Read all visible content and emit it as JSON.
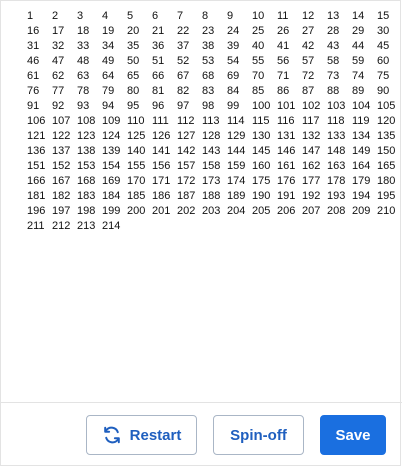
{
  "numbers": [
    "1",
    "2",
    "3",
    "4",
    "5",
    "6",
    "7",
    "8",
    "9",
    "10",
    "11",
    "12",
    "13",
    "14",
    "15",
    "16",
    "17",
    "18",
    "19",
    "20",
    "21",
    "22",
    "23",
    "24",
    "25",
    "26",
    "27",
    "28",
    "29",
    "30",
    "31",
    "32",
    "33",
    "34",
    "35",
    "36",
    "37",
    "38",
    "39",
    "40",
    "41",
    "42",
    "43",
    "44",
    "45",
    "46",
    "47",
    "48",
    "49",
    "50",
    "51",
    "52",
    "53",
    "54",
    "55",
    "56",
    "57",
    "58",
    "59",
    "60",
    "61",
    "62",
    "63",
    "64",
    "65",
    "66",
    "67",
    "68",
    "69",
    "70",
    "71",
    "72",
    "73",
    "74",
    "75",
    "76",
    "77",
    "78",
    "79",
    "80",
    "81",
    "82",
    "83",
    "84",
    "85",
    "86",
    "87",
    "88",
    "89",
    "90",
    "91",
    "92",
    "93",
    "94",
    "95",
    "96",
    "97",
    "98",
    "99",
    "100",
    "101",
    "102",
    "103",
    "104",
    "105",
    "106",
    "107",
    "108",
    "109",
    "110",
    "111",
    "112",
    "113",
    "114",
    "115",
    "116",
    "117",
    "118",
    "119",
    "120",
    "121",
    "122",
    "123",
    "124",
    "125",
    "126",
    "127",
    "128",
    "129",
    "130",
    "131",
    "132",
    "133",
    "134",
    "135",
    "136",
    "137",
    "138",
    "139",
    "140",
    "141",
    "142",
    "143",
    "144",
    "145",
    "146",
    "147",
    "148",
    "149",
    "150",
    "151",
    "152",
    "153",
    "154",
    "155",
    "156",
    "157",
    "158",
    "159",
    "160",
    "161",
    "162",
    "163",
    "164",
    "165",
    "166",
    "167",
    "168",
    "169",
    "170",
    "171",
    "172",
    "173",
    "174",
    "175",
    "176",
    "177",
    "178",
    "179",
    "180",
    "181",
    "182",
    "183",
    "184",
    "185",
    "186",
    "187",
    "188",
    "189",
    "190",
    "191",
    "192",
    "193",
    "194",
    "195",
    "196",
    "197",
    "198",
    "199",
    "200",
    "201",
    "202",
    "203",
    "204",
    "205",
    "206",
    "207",
    "208",
    "209",
    "210",
    "211",
    "212",
    "213",
    "214"
  ],
  "footer": {
    "restart_label": "Restart",
    "restart_icon": "refresh-icon",
    "spinoff_label": "Spin-off",
    "save_label": "Save"
  },
  "colors": {
    "accent": "#1a6fe0",
    "secondary_text": "#1f5fbf",
    "border": "#aab6c6"
  }
}
